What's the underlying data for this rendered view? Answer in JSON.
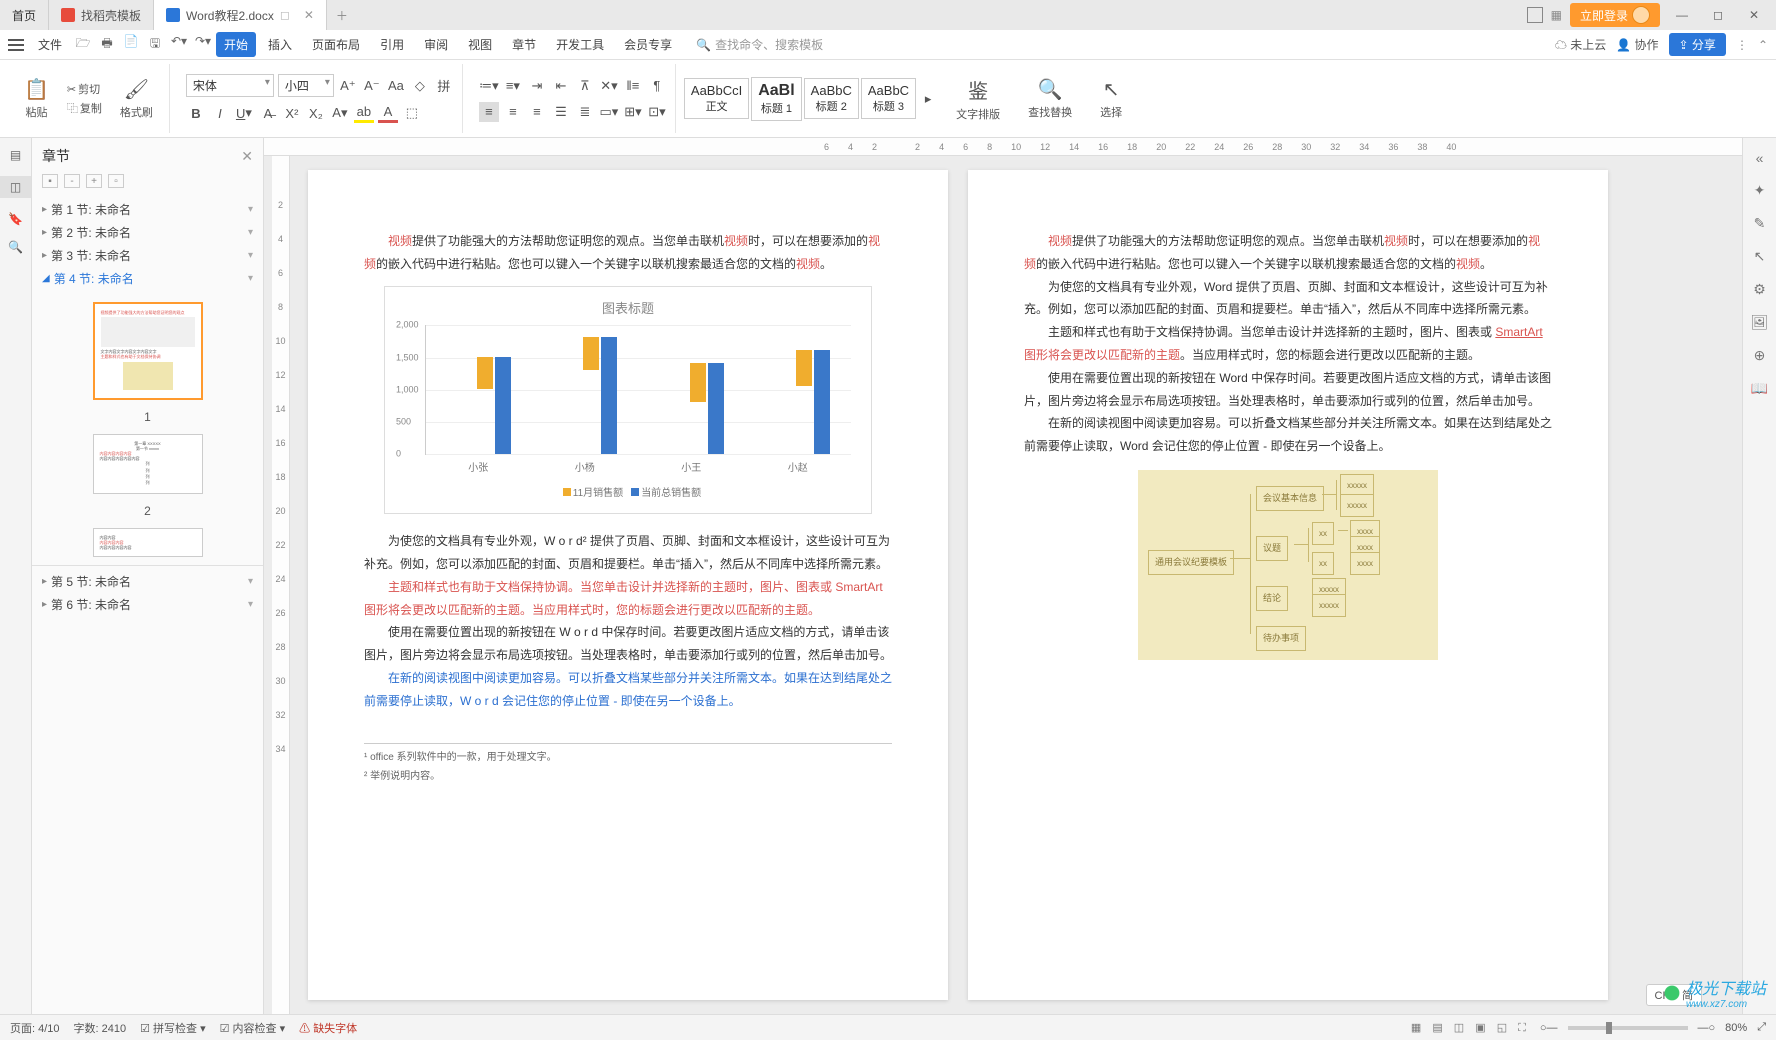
{
  "tabs": {
    "home": "首页",
    "template": "找稻壳模板",
    "doc": "Word教程2.docx"
  },
  "login": "立即登录",
  "menu": {
    "file": "文件",
    "items": [
      "开始",
      "插入",
      "页面布局",
      "引用",
      "审阅",
      "视图",
      "章节",
      "开发工具",
      "会员专享"
    ],
    "search_placeholder": "查找命令、搜索模板",
    "cloud": "未上云",
    "coop": "协作",
    "share": "分享"
  },
  "ribbon": {
    "paste": "粘贴",
    "cut": "剪切",
    "copy": "复制",
    "format_painter": "格式刷",
    "font_name": "宋体",
    "font_size": "小四",
    "styles": {
      "normal_prev": "AaBbCcI",
      "normal": "正文",
      "h1_prev": "AaBl",
      "h1": "标题 1",
      "h2_prev": "AaBbC",
      "h2": "标题 2",
      "h3_prev": "AaBbC",
      "h3": "标题 3"
    },
    "text_layout": "文字排版",
    "find_replace": "查找替换",
    "select": "选择"
  },
  "nav": {
    "title": "章节",
    "sections": [
      "第 1 节: 未命名",
      "第 2 节: 未命名",
      "第 3 节: 未命名",
      "第 4 节: 未命名",
      "第 5 节: 未命名",
      "第 6 节: 未命名"
    ],
    "thumb_nums": [
      "1",
      "2"
    ]
  },
  "ruler_h": [
    "6",
    "4",
    "2",
    "",
    "2",
    "4",
    "6",
    "8",
    "10",
    "12",
    "14",
    "16",
    "18",
    "20",
    "22",
    "24",
    "26",
    "28",
    "30",
    "32",
    "34",
    "36",
    "38",
    "40"
  ],
  "ruler_v": [
    "",
    "2",
    "4",
    "6",
    "8",
    "10",
    "12",
    "14",
    "16",
    "18",
    "20",
    "22",
    "24",
    "26",
    "28",
    "30",
    "32",
    "34"
  ],
  "page1": {
    "p1a": "视频",
    "p1b": "提供了功能强大的方法帮助您证明您的观点。当您单击联机",
    "p1c": "视频",
    "p1d": "时，可以在想要添加的",
    "p1e": "视频",
    "p1f": "的嵌入代码中进行粘贴。您也可以键入一个关键字以联机搜索最适合您的文档的",
    "p1g": "视频",
    "p1h": "。",
    "p2": "为使您的文档具有专业外观，W o r d² 提供了页眉、页脚、封面和文本框设计，这些设计可互为补充。例如，您可以添加匹配的封面、页眉和提要栏。单击“插入”，然后从不同库中选择所需元素。",
    "p3a": "主题和样式也有助于文档保持协调。当您单击设计并选择新的主题时，图片、图表或 ",
    "p3b": "SmartArt",
    "p3c": " 图形将会更改以匹配新的主题。当应用样式时，您的标题会进行更改以匹配新的主题。",
    "p4": "使用在需要位置出现的新按钮在 W o r d 中保存时间。若要更改图片适应文档的方式，请单击该图片，图片旁边将会显示布局选项按钮。当处理表格时，单击要添加行或列的位置，然后单击加号。",
    "p5a": "在新的阅读视图中阅读更加容易。可以折叠文档某些部分并关注所需文本。如果在达到结尾处之前需要停止读取，W o r d  会记住您的停止位置  -  即使在另一个设备上。",
    "foot1": "office 系列软件中的一款，用于处理文字。",
    "foot2": "举例说明内容。"
  },
  "page2": {
    "p1a": "视频",
    "p1b": "提供了功能强大的方法帮助您证明您的观点。当您单击联机",
    "p1c": "视频",
    "p1d": "时，可以在想要添加的",
    "p1e": "视频",
    "p1f": "的嵌入代码中进行粘贴。您也可以键入一个关键字以联机搜索最适合您的文档的",
    "p1g": "视频",
    "p1h": "。",
    "p2": "为使您的文档具有专业外观，Word 提供了页眉、页脚、封面和文本框设计，这些设计可互为补充。例如，您可以添加匹配的封面、页眉和提要栏。单击“插入”，然后从不同库中选择所需元素。",
    "p3a": "主题和样式也有助于文档保持协调。当您单击设计并选择新的主题时，图片、图表或 ",
    "p3b": "SmartArt",
    "p3c": " 图形将会更改以匹配新的主题",
    "p3d": "。当应用样式时，您的标题会进行更改以匹配新的主题。",
    "p4": "使用在需要位置出现的新按钮在 Word 中保存时间。若要更改图片适应文档的方式，请单击该图片，图片旁边将会显示布局选项按钮。当处理表格时，单击要添加行或列的位置，然后单击加号。",
    "p5": "在新的阅读视图中阅读更加容易。可以折叠文档某些部分并关注所需文本。如果在达到结尾处之前需要停止读取，Word 会记住您的停止位置 - 即使在另一个设备上。",
    "diag_center": "通用会议纪要模板",
    "diag_nodes": [
      "会议基本信息",
      "议题",
      "结论",
      "待办事项"
    ]
  },
  "chart_data": {
    "type": "bar",
    "title": "图表标题",
    "categories": [
      "小张",
      "小杨",
      "小王",
      "小赵"
    ],
    "series": [
      {
        "name": "11月销售额",
        "values": [
          500,
          500,
          600,
          550
        ]
      },
      {
        "name": "当前总销售额",
        "values": [
          1500,
          1800,
          1400,
          1600
        ]
      }
    ],
    "ylim": [
      0,
      2000
    ],
    "yticks": [
      0,
      500,
      1000,
      1500,
      2000
    ],
    "colors": {
      "series1": "#f0ad2e",
      "series2": "#3a78c9"
    }
  },
  "ime": "CH ♪ 简",
  "status": {
    "page": "页面: 4/10",
    "words": "字数: 2410",
    "spell": "拼写检查",
    "content": "内容检查",
    "missing_font": "缺失字体",
    "zoom": "80%"
  },
  "watermark": {
    "name": "极光下载站",
    "url": "www.xz7.com"
  }
}
